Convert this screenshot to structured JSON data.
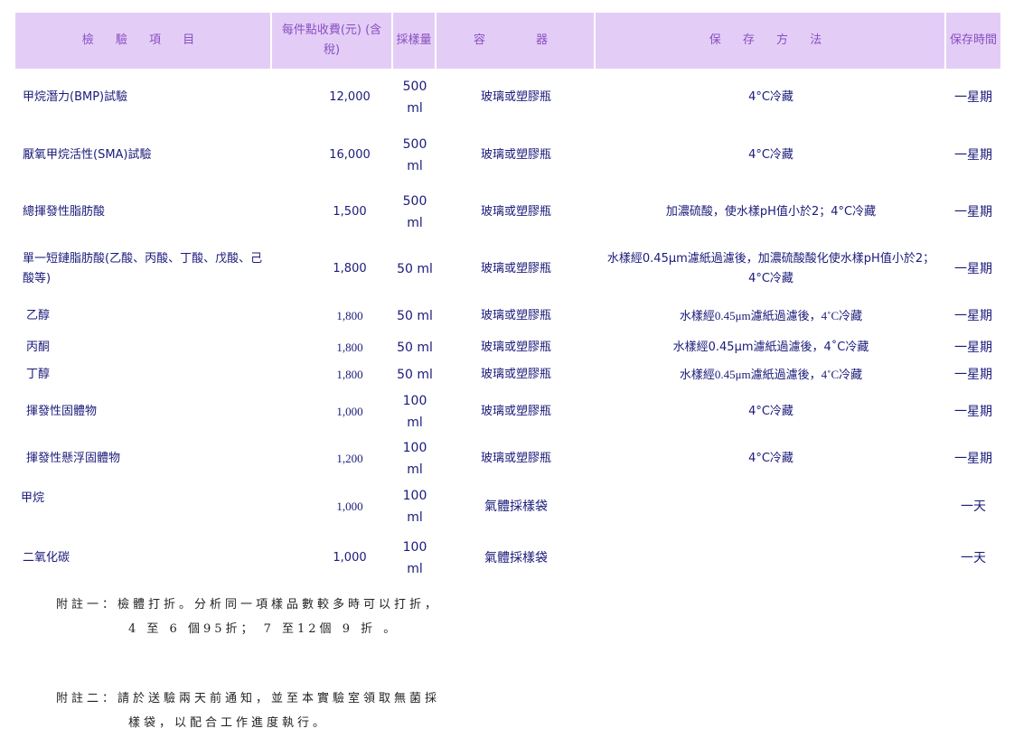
{
  "table": {
    "headers": {
      "item": "檢 驗 項 目",
      "fee": "每件點收費(元) (含稅)",
      "volume": "採樣量",
      "container": "容　　器",
      "method": "保 存 方 法",
      "keep": "保存時間"
    },
    "rows": [
      {
        "item": "甲烷潛力(BMP)試驗",
        "fee": "12,000",
        "volume": "500 ml",
        "container": "玻璃或塑膠瓶",
        "method": "4°C冷藏",
        "keep": "一星期"
      },
      {
        "item": "厭氧甲烷活性(SMA)試驗",
        "fee": "16,000",
        "volume": "500 ml",
        "container": "玻璃或塑膠瓶",
        "method": "4°C冷藏",
        "keep": "一星期"
      },
      {
        "item": "總揮發性脂肪酸",
        "fee": "1,500",
        "volume": "500 ml",
        "container": "玻璃或塑膠瓶",
        "method": "加濃硫酸，使水樣pH值小於2；4°C冷藏",
        "keep": "一星期"
      },
      {
        "item": "單一短鏈脂肪酸(乙酸、丙酸、丁酸、戊酸、己酸等)",
        "fee": "1,800",
        "volume": "50 ml",
        "container": "玻璃或塑膠瓶",
        "method": "水樣經0.45μm濾紙過濾後，加濃硫酸酸化使水樣pH值小於2；4°C冷藏",
        "keep": "一星期"
      },
      {
        "item": "乙醇",
        "fee": "1,800",
        "volume": "50 ml",
        "container": "玻璃或塑膠瓶",
        "method": "水樣經0.45μm濾紙過濾後，4˚C冷藏",
        "keep": "一星期"
      },
      {
        "item": "丙酮",
        "fee": "1,800",
        "volume": "50 ml",
        "container": "玻璃或塑膠瓶",
        "method": "水樣經0.45μm濾紙過濾後，4˚C冷藏",
        "keep": "一星期"
      },
      {
        "item": "丁醇",
        "fee": "1,800",
        "volume": "50 ml",
        "container": "玻璃或塑膠瓶",
        "method": "水樣經0.45μm濾紙過濾後，4˚C冷藏",
        "keep": "一星期"
      },
      {
        "item": "揮發性固體物",
        "fee": "1,000",
        "volume": "100 ml",
        "container": "玻璃或塑膠瓶",
        "method": "4°C冷藏",
        "keep": "一星期"
      },
      {
        "item": "揮發性懸浮固體物",
        "fee": "1,200",
        "volume": "100 ml",
        "container": "玻璃或塑膠瓶",
        "method": "4°C冷藏",
        "keep": "一星期"
      },
      {
        "item": "甲烷",
        "fee": "1,000",
        "volume": "100 ml",
        "container": "氣體採樣袋",
        "method": "",
        "keep": "一天"
      },
      {
        "item": "二氧化碳",
        "fee": "1,000",
        "volume": "100 ml",
        "container": "氣體採樣袋",
        "method": "",
        "keep": "一天"
      }
    ]
  },
  "notes": {
    "note1_line1": "附註一：檢體打折。分析同一項樣品數較多時可以打折，",
    "note1_line2": "4 至 6 個95折； 7 至12個 9 折 。",
    "note2_line1": "附註二：請於送驗兩天前通知，並至本實驗室領取無菌採",
    "note2_line2": "樣袋，以配合工作進度執行。"
  }
}
